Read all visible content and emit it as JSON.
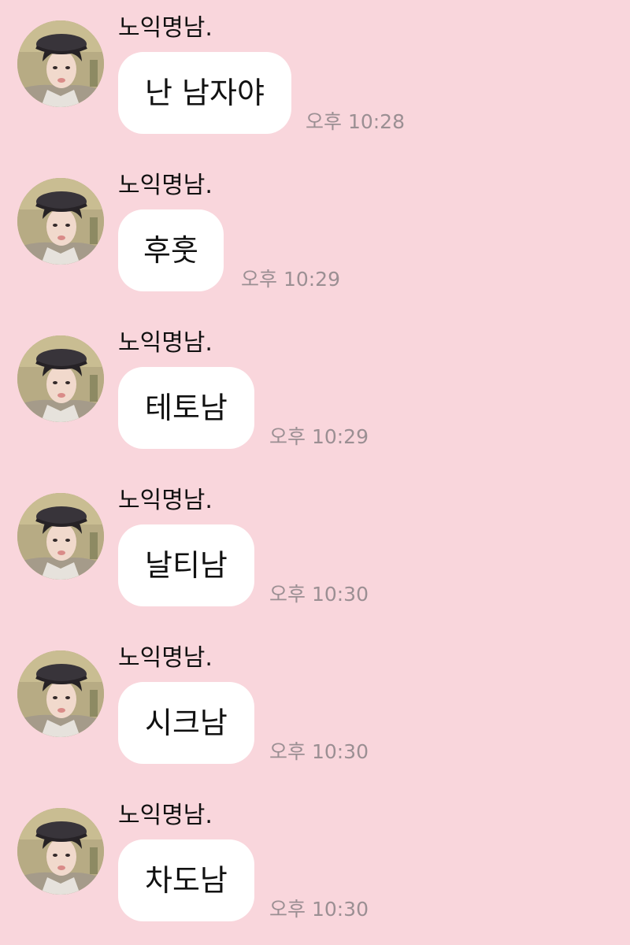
{
  "chat": {
    "messages": [
      {
        "sender": "노익명남.",
        "text": "난 남자야",
        "time": "오후 10:28",
        "avatar_icon": "profile-photo-icon"
      },
      {
        "sender": "노익명남.",
        "text": "후훗",
        "time": "오후 10:29",
        "avatar_icon": "profile-photo-icon"
      },
      {
        "sender": "노익명남.",
        "text": "테토남",
        "time": "오후 10:29",
        "avatar_icon": "profile-photo-icon"
      },
      {
        "sender": "노익명남.",
        "text": "날티남",
        "time": "오후 10:30",
        "avatar_icon": "profile-photo-icon"
      },
      {
        "sender": "노익명남.",
        "text": "시크남",
        "time": "오후 10:30",
        "avatar_icon": "profile-photo-icon"
      },
      {
        "sender": "노익명남.",
        "text": "차도남",
        "time": "오후 10:30",
        "avatar_icon": "profile-photo-icon"
      }
    ]
  },
  "colors": {
    "background": "#f9d6dc",
    "bubble": "#ffffff",
    "text": "#111111",
    "timestamp": "#9b8f93"
  }
}
